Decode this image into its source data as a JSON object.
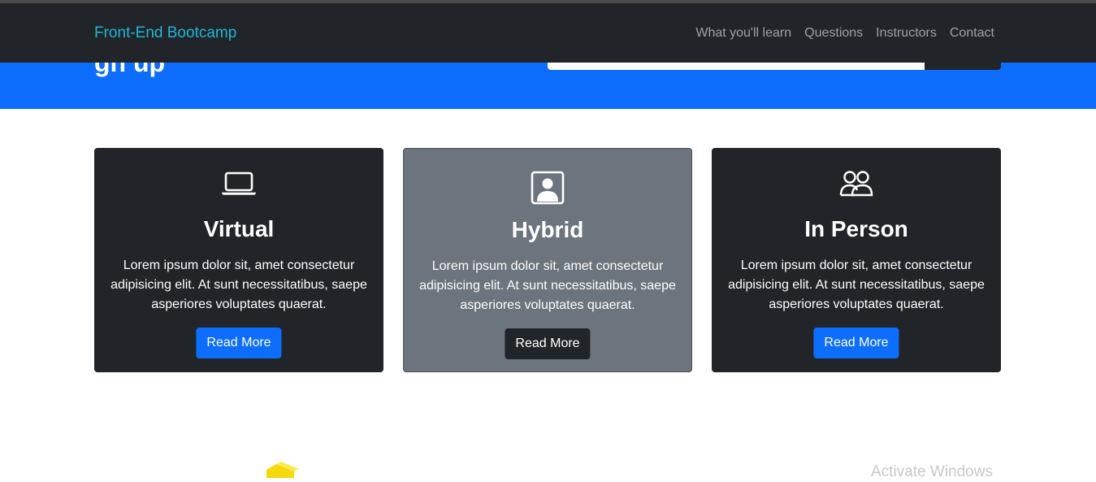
{
  "navbar": {
    "brand": "Front-End Bootcamp",
    "links": [
      "What you'll learn",
      "Questions",
      "Instructors",
      "Contact"
    ]
  },
  "hero": {
    "partial_heading": "gn up"
  },
  "cards": [
    {
      "icon": "laptop-icon",
      "title": "Virtual",
      "text": "Lorem ipsum dolor sit, amet consectetur adipisicing elit. At sunt necessitatibus, saepe asperiores voluptates quaerat.",
      "button": "Read More"
    },
    {
      "icon": "person-badge-icon",
      "title": "Hybrid",
      "text": "Lorem ipsum dolor sit, amet consectetur adipisicing elit. At sunt necessitatibus, saepe asperiores voluptates quaerat.",
      "button": "Read More"
    },
    {
      "icon": "people-icon",
      "title": "In Person",
      "text": "Lorem ipsum dolor sit, amet consectetur adipisicing elit. At sunt necessitatibus, saepe asperiores voluptates quaerat.",
      "button": "Read More"
    }
  ],
  "watermark": "Activate Windows",
  "colors": {
    "navbar": "#212529",
    "brand": "#22b5d8",
    "hero": "#0d6efd",
    "card_dark": "#212529",
    "card_gray": "#6c757d",
    "button_primary": "#0d6efd"
  }
}
